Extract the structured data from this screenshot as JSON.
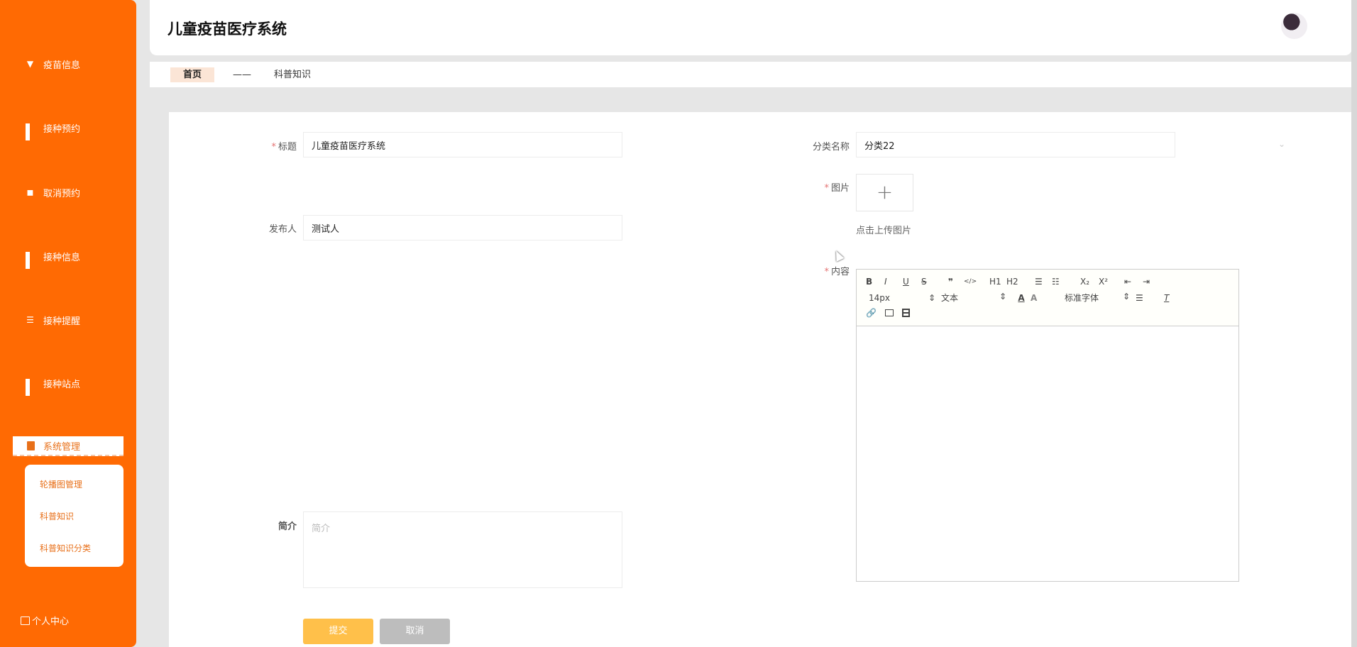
{
  "sidebar": {
    "items": [
      {
        "label": "疫苗信息"
      },
      {
        "label": "接种预约"
      },
      {
        "label": "取消预约"
      },
      {
        "label": "接种信息"
      },
      {
        "label": "接种提醒"
      },
      {
        "label": "接种站点"
      }
    ],
    "active": {
      "label": "系统管理"
    },
    "submenu": [
      {
        "label": "轮播图管理"
      },
      {
        "label": "科普知识"
      },
      {
        "label": "科普知识分类"
      }
    ],
    "personal": "个人中心"
  },
  "header": {
    "title": "儿童疫苗医疗系统"
  },
  "breadcrumb": {
    "home": "首页",
    "separator": "——",
    "current": "科普知识"
  },
  "form": {
    "title_label": "标题",
    "title_value": "儿童疫苗医疗系统",
    "publisher_label": "发布人",
    "publisher_value": "测试人",
    "summary_label": "简介",
    "summary_placeholder": "简介",
    "category_label": "分类名称",
    "category_value": "分类22",
    "image_label": "图片",
    "upload_hint": "点击上传图片",
    "content_label": "内容",
    "required_mark": "*",
    "submit": "提交",
    "cancel": "取消"
  },
  "editor": {
    "font_size": "14px",
    "header": "文本",
    "font": "标准字体",
    "buttons": [
      "B",
      "I",
      "U",
      "S",
      "❞",
      "</>",
      "H1",
      "H2",
      "☰",
      "☷",
      "X₂",
      "X²",
      "⇤",
      "⇥"
    ]
  }
}
